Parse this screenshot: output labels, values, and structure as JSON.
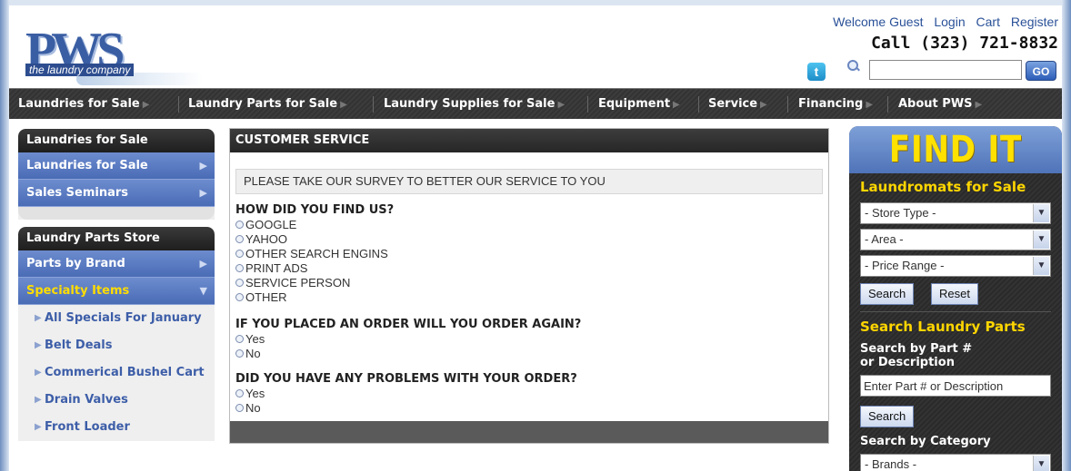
{
  "header": {
    "logo_text": "PWS",
    "logo_tagline": "the laundry company",
    "links": [
      "Welcome Guest",
      "Login",
      "Cart",
      "Register"
    ],
    "phone": "Call (323) 721-8832",
    "twitter_glyph": "t",
    "search_value": "",
    "go_label": "GO"
  },
  "nav": [
    {
      "label": "Laundries for Sale"
    },
    {
      "label": "Laundry Parts for Sale"
    },
    {
      "label": "Laundry Supplies for Sale"
    },
    {
      "label": "Equipment"
    },
    {
      "label": "Service"
    },
    {
      "label": "Financing"
    },
    {
      "label": "About PWS"
    }
  ],
  "left": {
    "box1": {
      "title": "Laundries for Sale",
      "links": [
        "Laundries for Sale",
        "Sales Seminars"
      ]
    },
    "box2": {
      "title": "Laundry Parts Store",
      "links": [
        "Parts by Brand",
        "Specialty Items"
      ],
      "sub_items": [
        "All Specials For January",
        "Belt Deals",
        "Commerical Bushel Cart",
        "Drain Valves",
        "Front Loader"
      ]
    }
  },
  "center": {
    "title": "CUSTOMER SERVICE",
    "banner": "PLEASE TAKE OUR SURVEY TO BETTER OUR SERVICE TO YOU",
    "q1": {
      "question": "HOW DID YOU FIND US?",
      "options": [
        "GOOGLE",
        "YAHOO",
        "OTHER SEARCH ENGINS",
        "PRINT ADS",
        "SERVICE PERSON",
        "OTHER"
      ]
    },
    "q2": {
      "question": "IF YOU PLACED AN ORDER WILL YOU ORDER AGAIN?",
      "options": [
        "Yes",
        "No"
      ]
    },
    "q3": {
      "question": "DID YOU HAVE ANY PROBLEMS WITH YOUR ORDER?",
      "options": [
        "Yes",
        "No"
      ]
    }
  },
  "right": {
    "banner": "FIND IT",
    "laundromats_title": "Laundromats for Sale",
    "store_type": "- Store Type -",
    "area": "- Area -",
    "price_range": "- Price Range -",
    "search_label": "Search",
    "reset_label": "Reset",
    "parts_title": "Search Laundry Parts",
    "part_label_1": "Search by Part #",
    "part_label_2": "or Description",
    "part_placeholder": "Enter Part # or Description",
    "part_search_label": "Search",
    "category_label": "Search by Category",
    "brands": "- Brands -"
  }
}
